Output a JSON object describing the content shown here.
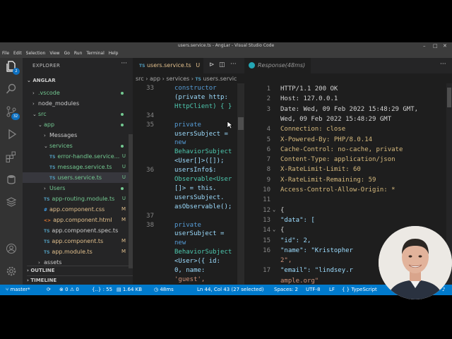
{
  "window": {
    "title": "users.service.ts - AngLar - Visual Studio Code"
  },
  "menu": [
    "File",
    "Edit",
    "Selection",
    "View",
    "Go",
    "Run",
    "Terminal",
    "Help"
  ],
  "activity": {
    "explorer_badge": "2",
    "scm_badge": "32"
  },
  "sidebar": {
    "title": "EXPLORER",
    "project": "ANGLAR",
    "outline": "OUTLINE",
    "timeline": "TIMELINE",
    "items": [
      {
        "label": ".vscode",
        "kind": "folder",
        "open": false,
        "indent": 1,
        "status": "",
        "dot": true
      },
      {
        "label": "node_modules",
        "kind": "folder",
        "open": false,
        "indent": 1,
        "status": "",
        "dot": false
      },
      {
        "label": "src",
        "kind": "folder",
        "open": true,
        "indent": 1,
        "status": "",
        "dot": true
      },
      {
        "label": "app",
        "kind": "folder",
        "open": true,
        "indent": 2,
        "status": "",
        "dot": true
      },
      {
        "label": "Messages",
        "kind": "folder",
        "open": false,
        "indent": 3,
        "status": "",
        "dot": false
      },
      {
        "label": "services",
        "kind": "folder",
        "open": true,
        "indent": 3,
        "status": "",
        "dot": true
      },
      {
        "label": "error-handle.service...",
        "kind": "ts",
        "indent": 4,
        "status": "U"
      },
      {
        "label": "message.service.ts",
        "kind": "ts",
        "indent": 4,
        "status": "U"
      },
      {
        "label": "users.service.ts",
        "kind": "ts",
        "indent": 4,
        "status": "U",
        "selected": true
      },
      {
        "label": "Users",
        "kind": "folder",
        "open": false,
        "indent": 3,
        "status": "",
        "dot": true
      },
      {
        "label": "app-routing.module.ts",
        "kind": "ts",
        "indent": 3,
        "status": "U"
      },
      {
        "label": "app.component.css",
        "kind": "css",
        "indent": 3,
        "status": "M"
      },
      {
        "label": "app.component.html",
        "kind": "html",
        "indent": 3,
        "status": "M"
      },
      {
        "label": "app.component.spec.ts",
        "kind": "ts",
        "indent": 3,
        "status": ""
      },
      {
        "label": "app.component.ts",
        "kind": "ts",
        "indent": 3,
        "status": "M"
      },
      {
        "label": "app.module.ts",
        "kind": "ts",
        "indent": 3,
        "status": "M"
      },
      {
        "label": "assets",
        "kind": "folder",
        "open": false,
        "indent": 2,
        "status": "",
        "dot": false
      }
    ]
  },
  "editor": {
    "tab_label": "users.service.ts",
    "tab_status": "U",
    "breadcrumb": [
      "src",
      "app",
      "services",
      "users.servic"
    ],
    "lines": [
      {
        "n": "33",
        "text": "constructor"
      },
      {
        "n": "",
        "text": "(private http:"
      },
      {
        "n": "",
        "text": "HttpClient) { }"
      },
      {
        "n": "34",
        "text": ""
      },
      {
        "n": "35",
        "text": "private"
      },
      {
        "n": "",
        "text": "usersSubject ="
      },
      {
        "n": "",
        "text": "new"
      },
      {
        "n": "",
        "text": "BehaviorSubject"
      },
      {
        "n": "",
        "text": "<User[]>([]);"
      },
      {
        "n": "36",
        "text": "usersInfo$:"
      },
      {
        "n": "",
        "text": "Observable<User"
      },
      {
        "n": "",
        "text": "[]> = this."
      },
      {
        "n": "",
        "text": "usersSubject."
      },
      {
        "n": "",
        "text": "asObservable();"
      },
      {
        "n": "37",
        "text": ""
      },
      {
        "n": "38",
        "text": "private"
      },
      {
        "n": "",
        "text": "userSubject ="
      },
      {
        "n": "",
        "text": "new"
      },
      {
        "n": "",
        "text": "BehaviorSubject"
      },
      {
        "n": "",
        "text": "<User>({ id:"
      },
      {
        "n": "",
        "text": "0, name:"
      },
      {
        "n": "",
        "text": "'guest',"
      }
    ]
  },
  "response": {
    "tab_label": "Response(48ms)",
    "lines": [
      {
        "n": "1",
        "text": "HTTP/1.1 200 OK",
        "color": "#d4d4d4"
      },
      {
        "n": "2",
        "text": "Host: 127.0.0.1",
        "color": "#d4d4d4"
      },
      {
        "n": "3",
        "text": "Date: Wed, 09 Feb 2022 15:48:29 GMT,",
        "color": "#d4d4d4"
      },
      {
        "n": "",
        "text": "Wed, 09 Feb 2022 15:48:29 GMT",
        "color": "#d4d4d4"
      },
      {
        "n": "4",
        "text": "Connection: close",
        "color": "#d7ba7d"
      },
      {
        "n": "5",
        "text": "X-Powered-By: PHP/8.0.14",
        "color": "#d7ba7d"
      },
      {
        "n": "6",
        "text": "Cache-Control: no-cache, private",
        "color": "#d7ba7d"
      },
      {
        "n": "7",
        "text": "Content-Type: application/json",
        "color": "#d7ba7d"
      },
      {
        "n": "8",
        "text": "X-RateLimit-Limit: 60",
        "color": "#d7ba7d"
      },
      {
        "n": "9",
        "text": "X-RateLimit-Remaining: 59",
        "color": "#d7ba7d"
      },
      {
        "n": "10",
        "text": "Access-Control-Allow-Origin: *",
        "color": "#d7ba7d"
      },
      {
        "n": "11",
        "text": "",
        "color": "#d4d4d4"
      },
      {
        "n": "12",
        "text": "{",
        "color": "#d4d4d4",
        "fold": true
      },
      {
        "n": "13",
        "text": "  \"data\": [",
        "color": "#9cdcfe"
      },
      {
        "n": "14",
        "text": "    {",
        "color": "#d4d4d4",
        "fold": true
      },
      {
        "n": "15",
        "text": "      \"id\": 2,",
        "color": "#9cdcfe"
      },
      {
        "n": "16",
        "text": "      \"name\": \"Kristopher",
        "color": "#9cdcfe"
      },
      {
        "n": "",
        "text": "2\",",
        "color": "#ce9178"
      },
      {
        "n": "17",
        "text": "      \"email\": \"lindsey.r",
        "color": "#9cdcfe"
      },
      {
        "n": "",
        "text": "ample.org\"",
        "color": "#ce9178"
      }
    ]
  },
  "statusbar": {
    "branch": "master*",
    "errors": "0",
    "warnings": "0",
    "braces": "{..} : 55",
    "size": "1.64 KB",
    "timing": "48ms",
    "position": "Ln 44, Col 43 (27 selected)",
    "spaces": "Spaces: 2",
    "encoding": "UTF-8",
    "eol": "LF",
    "language": "TypeScript"
  },
  "colors": {
    "accent": "#007acc",
    "ts_icon": "#519aba",
    "css_icon": "#42a5f5",
    "html_icon": "#e37933",
    "untracked": "#73c991",
    "modified": "#e2c08d"
  }
}
